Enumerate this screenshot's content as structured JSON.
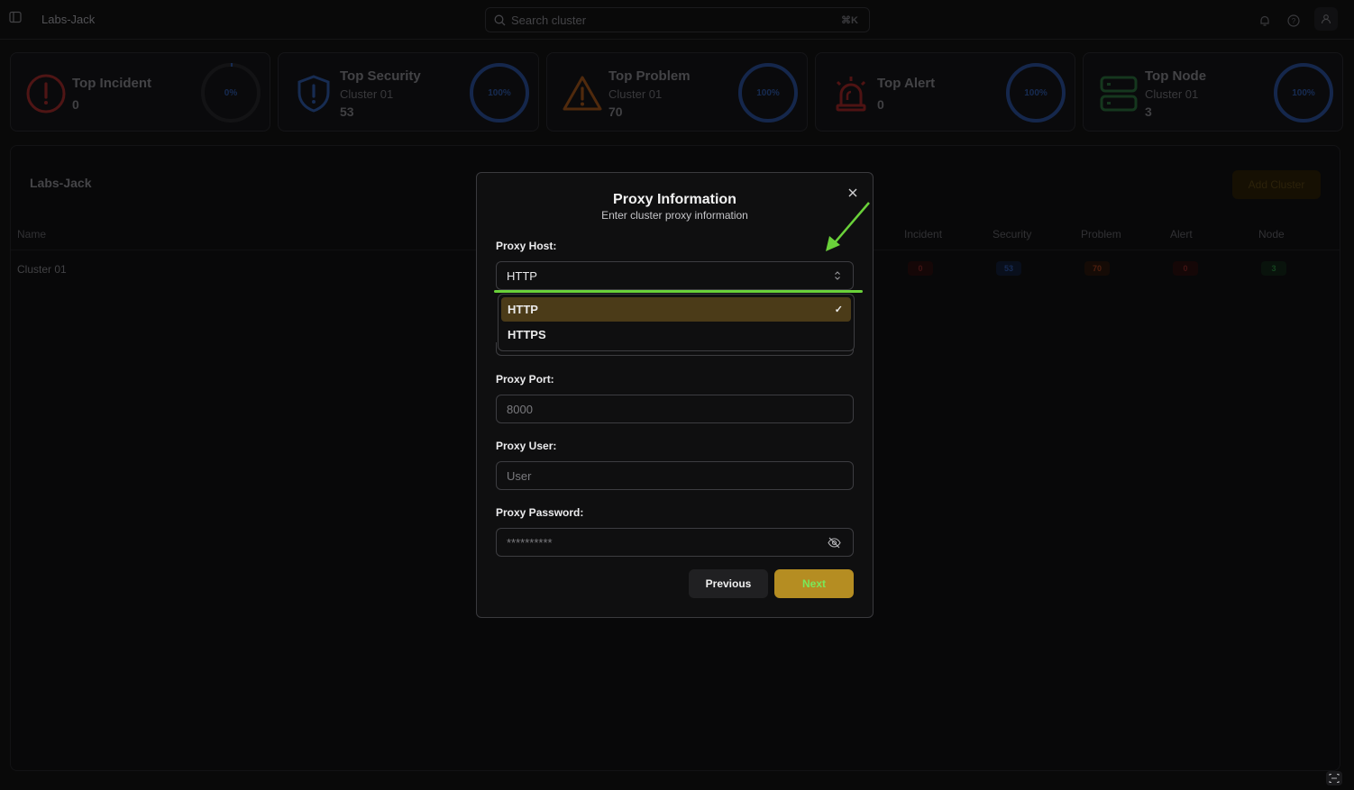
{
  "header": {
    "title": "Labs-Jack",
    "search_placeholder": "Search cluster",
    "shortcut": "⌘K",
    "icons": [
      "sidebar-toggle-icon",
      "bell-icon",
      "help-icon",
      "user-icon"
    ]
  },
  "stats": [
    {
      "title": "Top Incident",
      "subtitle": "",
      "value": "0",
      "percent": "0%",
      "icon": "alert-circle-icon",
      "color": "#7a1f1f"
    },
    {
      "title": "Top Security",
      "subtitle": "Cluster 01",
      "value": "53",
      "percent": "100%",
      "icon": "shield-alert-icon",
      "color": "#1e3a6e"
    },
    {
      "title": "Top Problem",
      "subtitle": "Cluster 01",
      "value": "70",
      "percent": "100%",
      "icon": "warning-triangle-icon",
      "color": "#6e3a12"
    },
    {
      "title": "Top Alert",
      "subtitle": "",
      "value": "0",
      "percent": "100%",
      "icon": "siren-icon",
      "color": "#6e1a1a"
    },
    {
      "title": "Top Node",
      "subtitle": "Cluster 01",
      "value": "3",
      "percent": "100%",
      "icon": "server-icon",
      "color": "#1a4a2a"
    }
  ],
  "panel": {
    "title": "Labs-Jack",
    "add_button": "Add Cluster",
    "columns": [
      "Name",
      "Incident",
      "Security",
      "Problem",
      "Alert",
      "Node"
    ],
    "rows": [
      {
        "name": "Cluster 01",
        "incident": "0",
        "security": "53",
        "problem": "70",
        "alert": "0",
        "node": "3"
      }
    ]
  },
  "modal": {
    "title": "Proxy Information",
    "subtitle": "Enter cluster proxy information",
    "fields": {
      "host_label": "Proxy Host:",
      "host_value": "HTTP",
      "host_options": [
        "HTTP",
        "HTTPS"
      ],
      "port_label": "Proxy Port:",
      "port_placeholder": "8000",
      "user_label": "Proxy User:",
      "user_placeholder": "User",
      "password_label": "Proxy Password:",
      "password_placeholder": "**********"
    },
    "buttons": {
      "previous": "Previous",
      "next": "Next"
    }
  },
  "colors": {
    "accent": "#b58d22",
    "annotation": "#6ad13a"
  }
}
